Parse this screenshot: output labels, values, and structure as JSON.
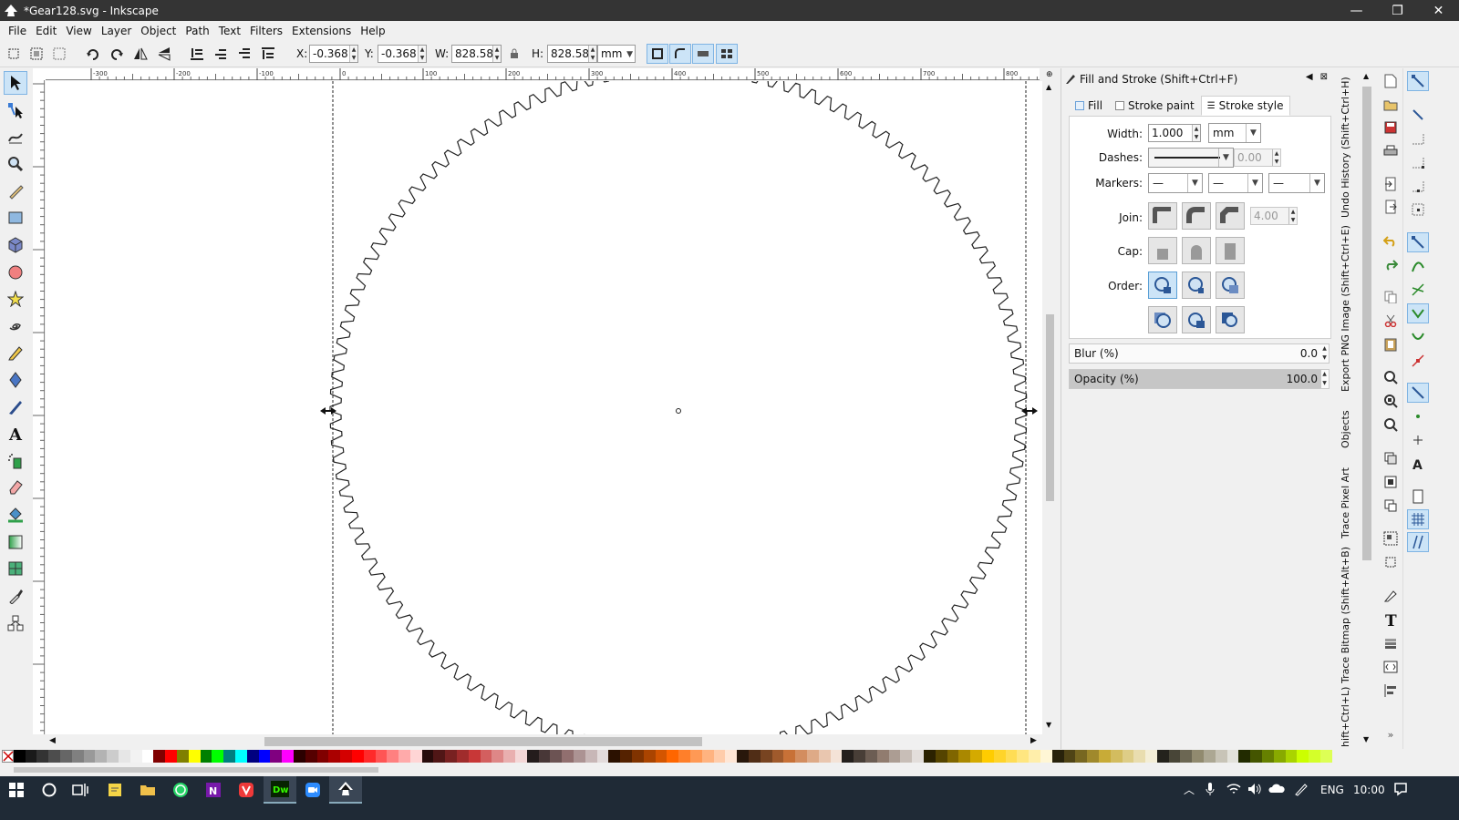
{
  "window": {
    "title": "*Gear128.svg - Inkscape",
    "minimize": "—",
    "maximize": "❐",
    "close": "✕"
  },
  "menu": [
    "File",
    "Edit",
    "View",
    "Layer",
    "Object",
    "Path",
    "Text",
    "Filters",
    "Extensions",
    "Help"
  ],
  "tool_controls": {
    "x_label": "X:",
    "x_value": "-0.368",
    "y_label": "Y:",
    "y_value": "-0.368",
    "w_label": "W:",
    "w_value": "828.589",
    "h_label": "H:",
    "h_value": "828.589",
    "unit": "mm"
  },
  "ruler": {
    "top_labels": [
      "-300",
      "-200",
      "-100",
      "0",
      "100",
      "200",
      "300",
      "400",
      "500",
      "600",
      "700",
      "800"
    ]
  },
  "fill_stroke": {
    "title": "Fill and Stroke (Shift+Ctrl+F)",
    "tabs": [
      "Fill",
      "Stroke paint",
      "Stroke style"
    ],
    "width_label": "Width:",
    "width_value": "1.000",
    "width_unit": "mm",
    "dashes_label": "Dashes:",
    "dash_offset": "0.00",
    "markers_label": "Markers:",
    "marker_start": "—",
    "marker_mid": "—",
    "marker_end": "—",
    "join_label": "Join:",
    "miter_limit": "4.00",
    "cap_label": "Cap:",
    "order_label": "Order:",
    "blur_label": "Blur (%)",
    "blur_value": "0.0",
    "blur_percent": 0,
    "opacity_label": "Opacity (%)",
    "opacity_value": "100.0",
    "opacity_percent": 100
  },
  "dock_tabs": [
    "Undo History (Shift+Ctrl+H)",
    "Export PNG Image (Shift+Ctrl+E)",
    "Objects",
    "Trace Pixel Art",
    "Trace Bitmap (Shift+Alt+B)",
    "hift+Ctrl+L)"
  ],
  "palette_colors": [
    "#000000",
    "#1a1a1a",
    "#333333",
    "#4d4d4d",
    "#666666",
    "#808080",
    "#999999",
    "#b3b3b3",
    "#cccccc",
    "#e6e6e6",
    "#f2f2f2",
    "#ffffff",
    "#800000",
    "#ff0000",
    "#808000",
    "#ffff00",
    "#008000",
    "#00ff00",
    "#008080",
    "#00ffff",
    "#000080",
    "#0000ff",
    "#800080",
    "#ff00ff",
    "#2b0000",
    "#550000",
    "#800000",
    "#aa0000",
    "#d40000",
    "#ff0000",
    "#ff2a2a",
    "#ff5555",
    "#ff8080",
    "#ffaaaa",
    "#ffd5d5",
    "#280b0b",
    "#501616",
    "#782121",
    "#a02c2c",
    "#c83737",
    "#d35f5f",
    "#de8787",
    "#e9afaf",
    "#f4d7d7",
    "#241c1c",
    "#483737",
    "#6c5353",
    "#916f6f",
    "#ac9393",
    "#c8b7b7",
    "#e3dbdb",
    "#2b1100",
    "#552200",
    "#803300",
    "#aa4400",
    "#d45500",
    "#ff6600",
    "#ff7f2a",
    "#ff9955",
    "#ffb380",
    "#ffccaa",
    "#ffe6d5",
    "#28170b",
    "#502d16",
    "#784421",
    "#a05a2c",
    "#c87137",
    "#d38d5f",
    "#deaa87",
    "#e9c6af",
    "#f4e3d7",
    "#241f1c",
    "#483e37",
    "#6c5d53",
    "#917c6f",
    "#ac9d93",
    "#c8beb7",
    "#e3dedb",
    "#2b2200",
    "#554400",
    "#806600",
    "#aa8800",
    "#d4aa00",
    "#ffcc00",
    "#ffd42a",
    "#ffdd55",
    "#ffe680",
    "#ffeeaa",
    "#fff6d5",
    "#28220b",
    "#504416",
    "#786721",
    "#a0892c",
    "#c8ab37",
    "#d3bc5f",
    "#decd87",
    "#e9ddaf",
    "#f4eed7",
    "#24221c",
    "#484537",
    "#6c6753",
    "#918a6f",
    "#aca793",
    "#c8c4b7",
    "#e3e2db",
    "#222b00",
    "#445500",
    "#668000",
    "#88aa00",
    "#aad400",
    "#ccff00",
    "#d4ff2a",
    "#ddff55"
  ],
  "taskbar": {
    "language": "ENG",
    "time": "10:00"
  }
}
